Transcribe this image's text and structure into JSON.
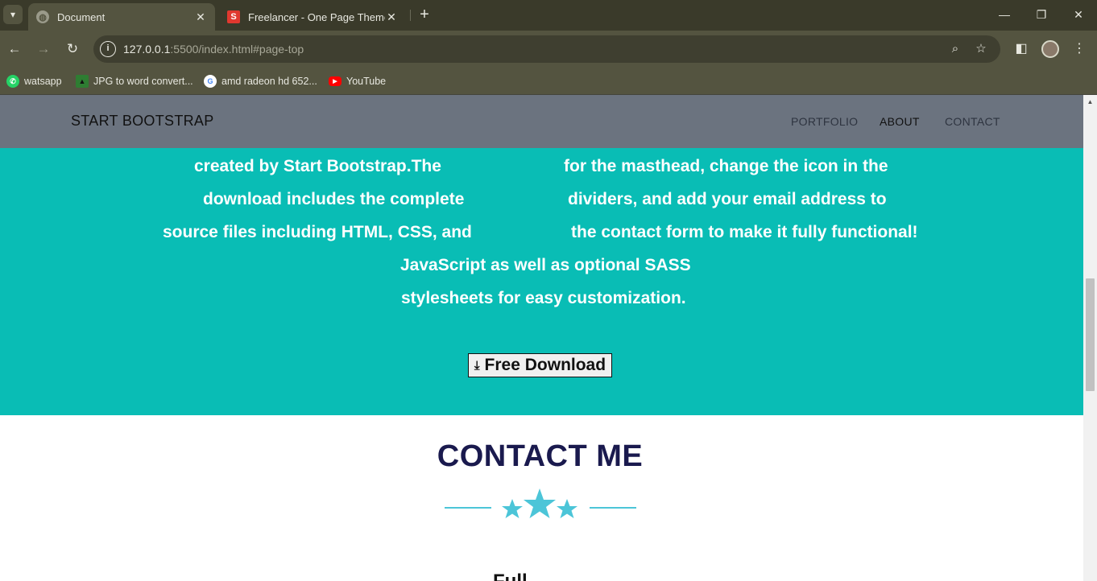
{
  "browser": {
    "tabs": [
      {
        "title": "Document",
        "active": true,
        "favicon": "globe-icon"
      },
      {
        "title": "Freelancer - One Page Theme -",
        "active": false,
        "favicon": "S"
      }
    ],
    "url_host": "127.0.0.1",
    "url_rest": ":5500/index.html#page-top",
    "bookmarks": [
      {
        "label": "watsapp",
        "icon": "whatsapp-icon",
        "color": "#25d366"
      },
      {
        "label": "JPG to word convert...",
        "icon": "jpg-converter-icon",
        "color": "#2e7d32"
      },
      {
        "label": "amd radeon hd 652...",
        "icon": "google-icon",
        "color": "#ffffff"
      },
      {
        "label": "YouTube",
        "icon": "youtube-icon",
        "color": "#ff0000"
      }
    ]
  },
  "site": {
    "brand": "START BOOTSTRAP",
    "nav": [
      "PORTFOLIO",
      "ABOUT",
      "CONTACT"
    ],
    "about_left": [
      "created by Start Bootstrap.The",
      "download includes the complete",
      "source files including HTML, CSS, and",
      "JavaScript as well as optional SASS",
      "stylesheets for easy customization."
    ],
    "about_right": [
      "for the masthead, change the icon in the",
      "dividers, and add your email address to",
      "the contact form to make it fully functional!"
    ],
    "download_label": "Free Download",
    "contact_title": "CONTACT ME",
    "follow_label": "Full"
  },
  "colors": {
    "about_bg": "#09bdb5",
    "nav_bg": "#6b737f",
    "heading": "#1a1a4e",
    "divider": "#4cc5d8"
  }
}
